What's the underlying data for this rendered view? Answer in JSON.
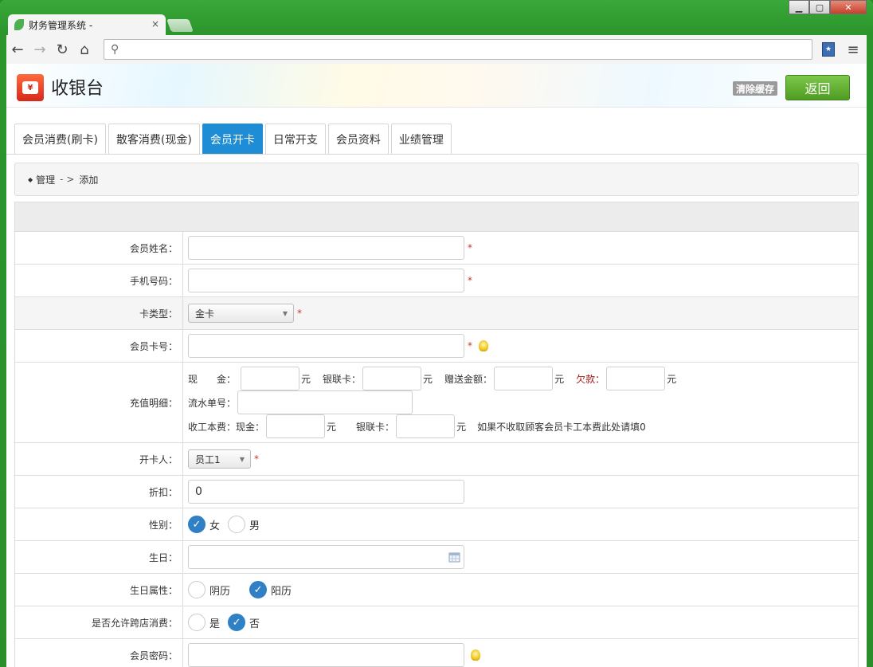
{
  "browser": {
    "tab_title": "财务管理系统 -",
    "tab_close": "×",
    "address": ""
  },
  "header": {
    "title": "收银台",
    "clear_cache": "清除缓存",
    "back": "返回"
  },
  "tabs": [
    {
      "label": "会员消费(刷卡)"
    },
    {
      "label": "散客消费(现金)"
    },
    {
      "label": "会员开卡"
    },
    {
      "label": "日常开支"
    },
    {
      "label": "会员资料"
    },
    {
      "label": "业绩管理"
    }
  ],
  "breadcrumb": {
    "item1": "管理",
    "sep": "- >",
    "item2": "添加"
  },
  "form": {
    "name_label": "会员姓名：",
    "phone_label": "手机号码：",
    "card_type_label": "卡类型：",
    "card_type_value": "金卡",
    "card_no_label": "会员卡号：",
    "recharge_label": "充值明细：",
    "cash_label": "现　　金：",
    "yuan": "元",
    "bankcard_label": "银联卡：",
    "gift_label": "赠送金额：",
    "owe_label": "欠款：",
    "serial_label": "流水单号：",
    "fee_label": "收工本费：",
    "fee_cash_label": "现金：",
    "fee_note": "如果不收取顾客会员卡工本费此处请填0",
    "opener_label": "开卡人：",
    "opener_value": "员工1",
    "discount_label": "折扣：",
    "discount_value": "0",
    "gender_label": "性别：",
    "female": "女",
    "male": "男",
    "birthday_label": "生日：",
    "bday_type_label": "生日属性：",
    "lunar": "阴历",
    "solar": "阳历",
    "cross_store_label": "是否允许跨店消费：",
    "yes": "是",
    "no": "否",
    "password_label": "会员密码：",
    "required": "*"
  },
  "colors": {
    "active_tab": "#1f8dd6",
    "back_button": "#5faf2d",
    "required": "#c0392b",
    "radio_on": "#2f80c4"
  }
}
